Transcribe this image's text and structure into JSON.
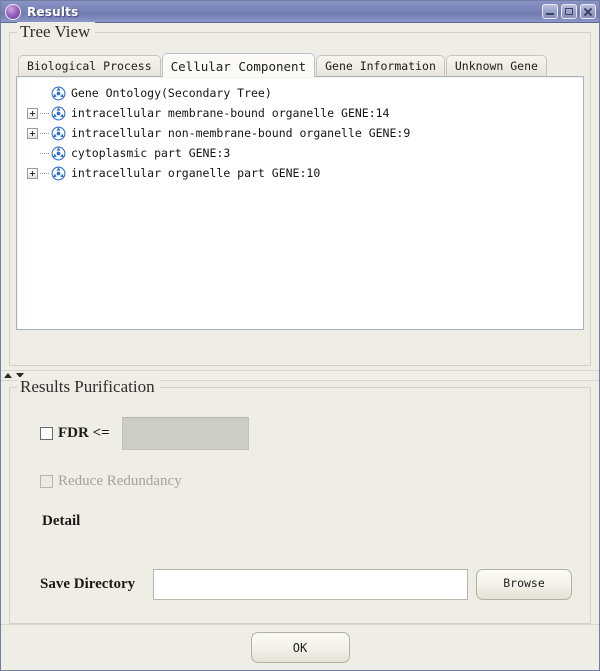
{
  "window": {
    "title": "Results",
    "icon": "app-icon",
    "controls": {
      "minimize": "minimize-button",
      "maximize": "maximize-button",
      "close": "close-button"
    }
  },
  "tree_view": {
    "panel_title": "Tree View",
    "tabs": [
      {
        "label": "Biological Process",
        "selected": false
      },
      {
        "label": "Cellular Component",
        "selected": true
      },
      {
        "label": "Gene Information",
        "selected": false
      },
      {
        "label": "Unknown Gene",
        "selected": false
      }
    ],
    "tree": [
      {
        "label": "Gene Ontology(Secondary Tree)",
        "level": 0,
        "expandable": false
      },
      {
        "label": "intracellular membrane-bound organelle GENE:14",
        "level": 1,
        "expandable": true
      },
      {
        "label": "intracellular non-membrane-bound organelle GENE:9",
        "level": 1,
        "expandable": true
      },
      {
        "label": "cytoplasmic part GENE:3",
        "level": 1,
        "expandable": false
      },
      {
        "label": "intracellular organelle part GENE:10",
        "level": 1,
        "expandable": true
      }
    ]
  },
  "results_purification": {
    "panel_title": "Results Purification",
    "fdr_label": "FDR <=",
    "fdr_value": "",
    "fdr_checked": false,
    "reduce_redundancy_label": "Reduce Redundancy",
    "reduce_redundancy_enabled": false,
    "detail_label": "Detail",
    "save_directory_label": "Save Directory",
    "save_directory_value": "",
    "browse_label": "Browse"
  },
  "footer": {
    "ok_label": "OK"
  },
  "colors": {
    "window_background": "#efeee6",
    "titlebar": "#7b85ba",
    "tree_background": "#ffffff",
    "disabled_field": "#cdcdc8",
    "tree_icon": "#2f6fd0"
  }
}
